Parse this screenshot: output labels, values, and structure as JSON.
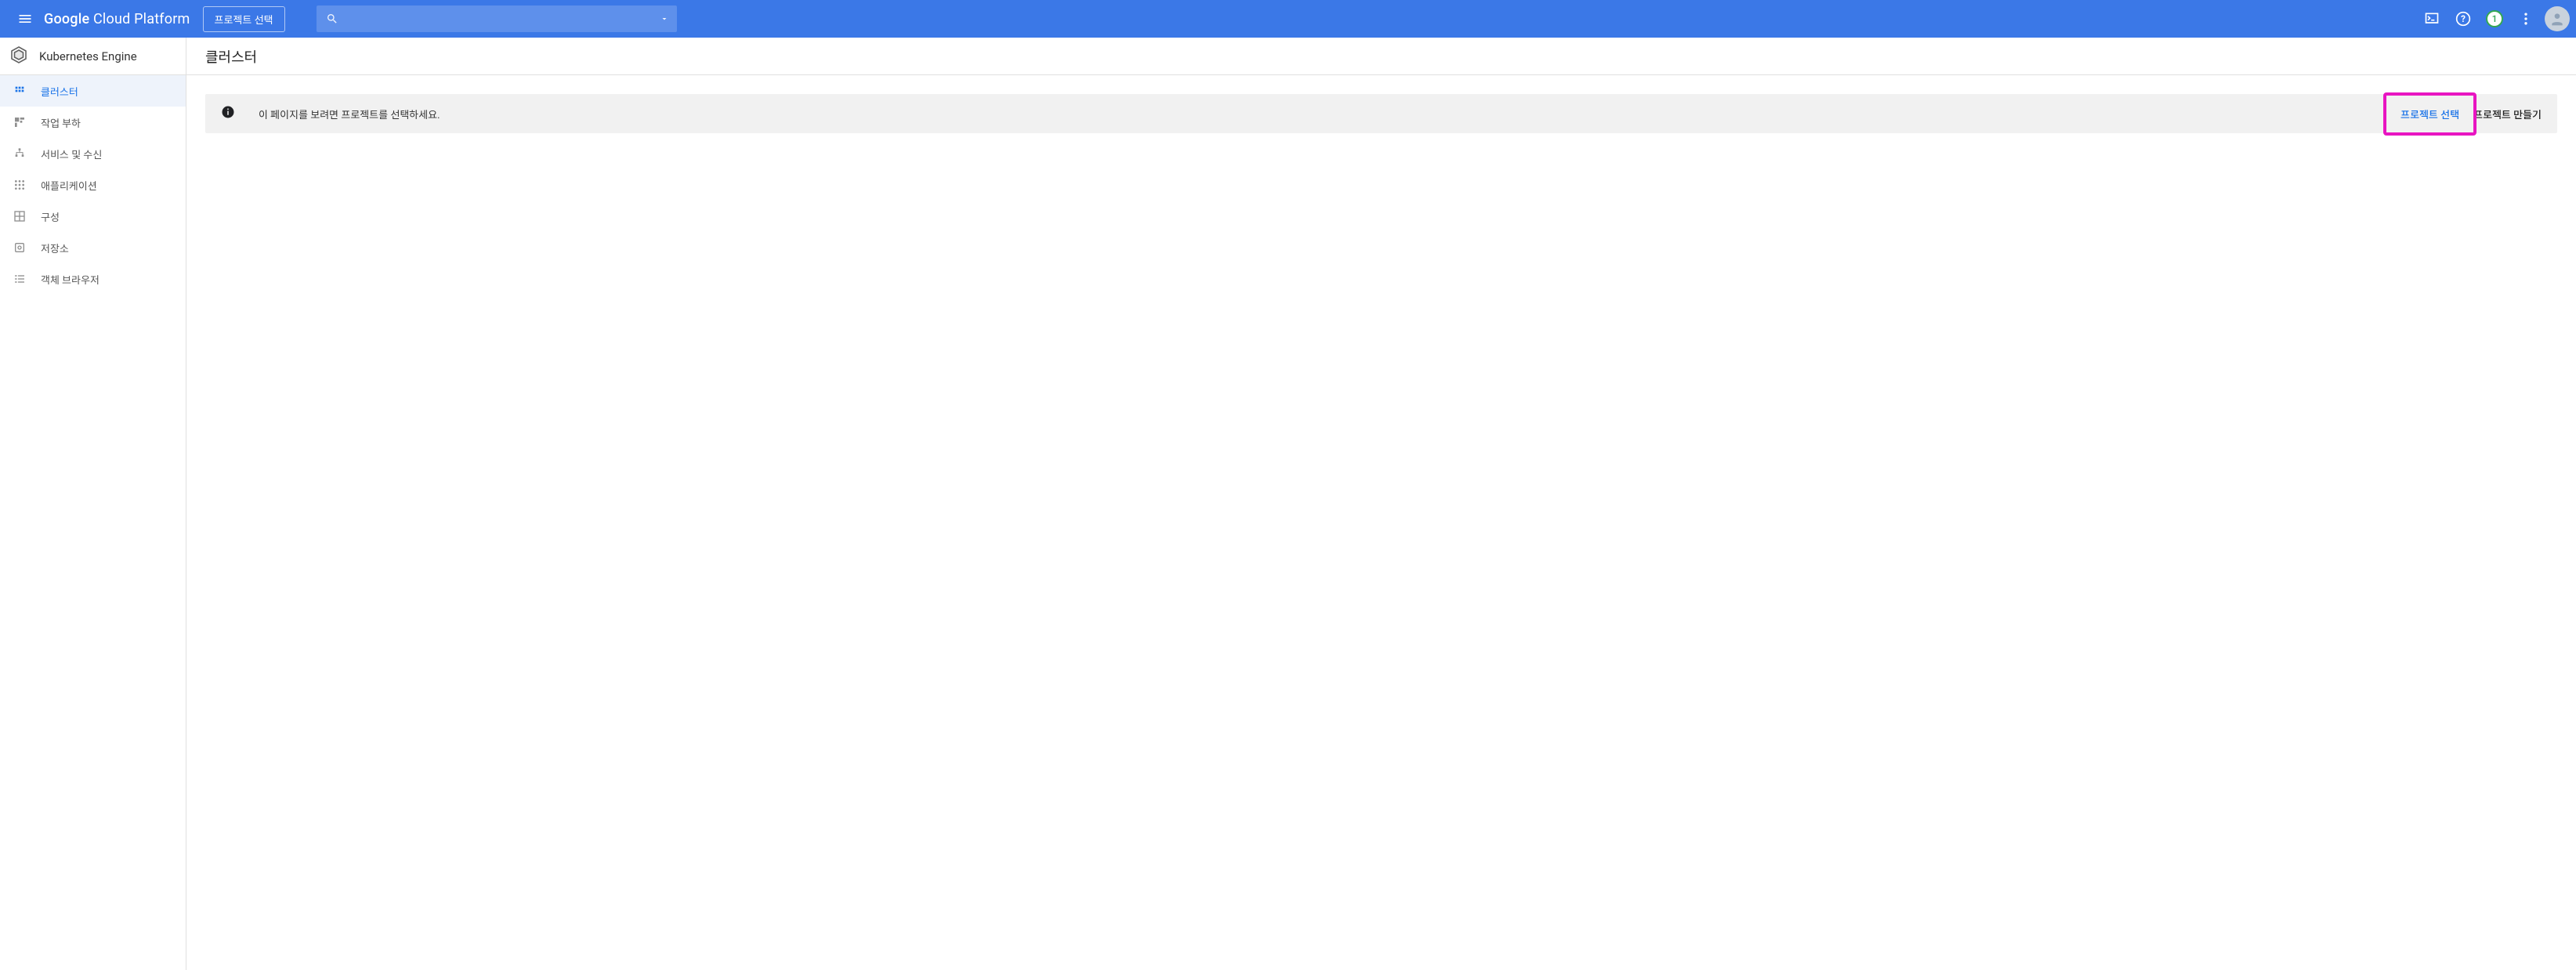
{
  "topbar": {
    "brand_html": "Google Cloud Platform",
    "project_chip": "프로젝트 선택",
    "notifications_count": "1"
  },
  "sidebar": {
    "product_title": "Kubernetes Engine",
    "items": [
      {
        "label": "클러스터"
      },
      {
        "label": "작업 부하"
      },
      {
        "label": "서비스 및 수신"
      },
      {
        "label": "애플리케이션"
      },
      {
        "label": "구성"
      },
      {
        "label": "저장소"
      },
      {
        "label": "객체 브라우저"
      }
    ]
  },
  "page": {
    "title": "클러스터",
    "banner_message": "이 페이지를 보려면 프로젝트를 선택하세요.",
    "banner_primary_action": "프로젝트 선택",
    "banner_secondary_action": "프로젝트 만들기"
  },
  "highlight": {
    "target": "banner_primary_action"
  }
}
